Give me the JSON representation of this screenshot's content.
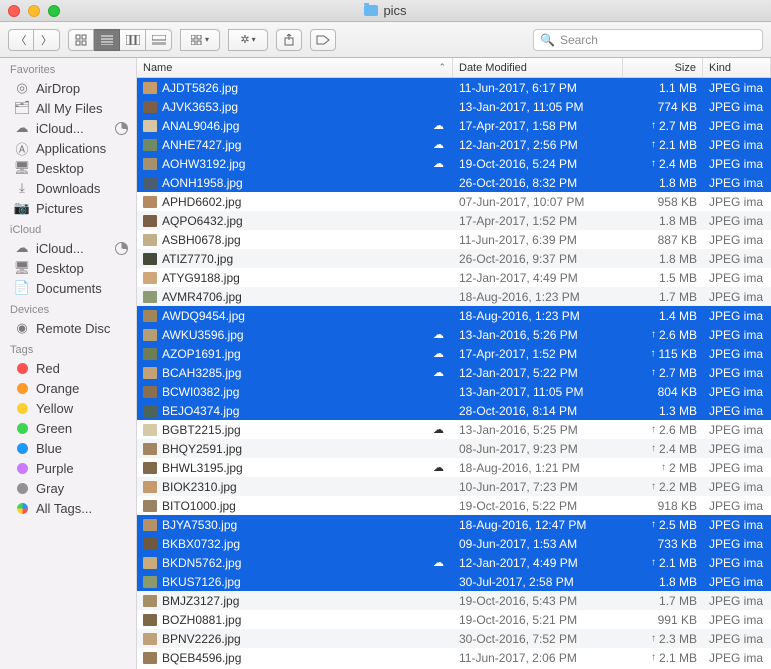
{
  "window": {
    "title": "pics"
  },
  "search": {
    "placeholder": "Search"
  },
  "sidebar": {
    "sections": [
      {
        "header": "Favorites",
        "items": [
          {
            "icon": "airdrop",
            "label": "AirDrop"
          },
          {
            "icon": "allfiles",
            "label": "All My Files"
          },
          {
            "icon": "cloud",
            "label": "iCloud...",
            "pie": true
          },
          {
            "icon": "apps",
            "label": "Applications"
          },
          {
            "icon": "desktop",
            "label": "Desktop"
          },
          {
            "icon": "downloads",
            "label": "Downloads"
          },
          {
            "icon": "pictures",
            "label": "Pictures"
          }
        ]
      },
      {
        "header": "iCloud",
        "items": [
          {
            "icon": "cloud",
            "label": "iCloud...",
            "pie": true
          },
          {
            "icon": "desktop",
            "label": "Desktop"
          },
          {
            "icon": "documents",
            "label": "Documents"
          }
        ]
      },
      {
        "header": "Devices",
        "items": [
          {
            "icon": "disc",
            "label": "Remote Disc"
          }
        ]
      },
      {
        "header": "Tags",
        "items": [
          {
            "dot": "red",
            "label": "Red"
          },
          {
            "dot": "orange",
            "label": "Orange"
          },
          {
            "dot": "yellow",
            "label": "Yellow"
          },
          {
            "dot": "green",
            "label": "Green"
          },
          {
            "dot": "blue",
            "label": "Blue"
          },
          {
            "dot": "purple",
            "label": "Purple"
          },
          {
            "dot": "gray",
            "label": "Gray"
          },
          {
            "dot": "all",
            "label": "All Tags..."
          }
        ]
      }
    ]
  },
  "columns": {
    "name": "Name",
    "date": "Date Modified",
    "size": "Size",
    "kind": "Kind"
  },
  "kind_label": "JPEG ima",
  "files": [
    {
      "name": "AJDT5826.jpg",
      "date": "11-Jun-2017, 6:17 PM",
      "size": "1.1 MB",
      "sel": true,
      "thumb": "#c99b6a"
    },
    {
      "name": "AJVK3653.jpg",
      "date": "13-Jan-2017, 11:05 PM",
      "size": "774 KB",
      "sel": true,
      "thumb": "#7d5f48"
    },
    {
      "name": "ANAL9046.jpg",
      "date": "17-Apr-2017, 1:58 PM",
      "size": "2.7 MB",
      "sel": true,
      "cloud": true,
      "up": true,
      "thumb": "#d8c7a2"
    },
    {
      "name": "ANHE7427.jpg",
      "date": "12-Jan-2017, 2:56 PM",
      "size": "2.1 MB",
      "sel": true,
      "cloud": true,
      "up": true,
      "thumb": "#6f8a64"
    },
    {
      "name": "AOHW3192.jpg",
      "date": "19-Oct-2016, 5:24 PM",
      "size": "2.4 MB",
      "sel": true,
      "cloud": true,
      "up": true,
      "thumb": "#a7916d"
    },
    {
      "name": "AONH1958.jpg",
      "date": "26-Oct-2016, 8:32 PM",
      "size": "1.8 MB",
      "sel": true,
      "thumb": "#4b5d6e"
    },
    {
      "name": "APHD6602.jpg",
      "date": "07-Jun-2017, 10:07 PM",
      "size": "958 KB",
      "sel": false,
      "thumb": "#b58a60"
    },
    {
      "name": "AQPO6432.jpg",
      "date": "17-Apr-2017, 1:52 PM",
      "size": "1.8 MB",
      "sel": false,
      "thumb": "#7c6045"
    },
    {
      "name": "ASBH0678.jpg",
      "date": "11-Jun-2017, 6:39 PM",
      "size": "887 KB",
      "sel": false,
      "thumb": "#c2b089"
    },
    {
      "name": "ATIZ7770.jpg",
      "date": "26-Oct-2016, 9:37 PM",
      "size": "1.8 MB",
      "sel": false,
      "thumb": "#454b3a"
    },
    {
      "name": "ATYG9188.jpg",
      "date": "12-Jan-2017, 4:49 PM",
      "size": "1.5 MB",
      "sel": false,
      "thumb": "#d0a77a"
    },
    {
      "name": "AVMR4706.jpg",
      "date": "18-Aug-2016, 1:23 PM",
      "size": "1.7 MB",
      "sel": false,
      "thumb": "#8e9c76"
    },
    {
      "name": "AWDQ9454.jpg",
      "date": "18-Aug-2016, 1:23 PM",
      "size": "1.4 MB",
      "sel": true,
      "thumb": "#a08658"
    },
    {
      "name": "AWKU3596.jpg",
      "date": "13-Jan-2016, 5:26 PM",
      "size": "2.6 MB",
      "sel": true,
      "cloud": true,
      "up": true,
      "thumb": "#b79d73"
    },
    {
      "name": "AZOP1691.jpg",
      "date": "17-Apr-2017, 1:52 PM",
      "size": "115 KB",
      "sel": true,
      "cloud": true,
      "up": true,
      "thumb": "#6d7d55"
    },
    {
      "name": "BCAH3285.jpg",
      "date": "12-Jan-2017, 5:22 PM",
      "size": "2.7 MB",
      "sel": true,
      "cloud": true,
      "up": true,
      "thumb": "#c5a178"
    },
    {
      "name": "BCWI0382.jpg",
      "date": "13-Jan-2017, 11:05 PM",
      "size": "804 KB",
      "sel": true,
      "thumb": "#8c6f4e"
    },
    {
      "name": "BEJO4374.jpg",
      "date": "28-Oct-2016, 8:14 PM",
      "size": "1.3 MB",
      "sel": true,
      "thumb": "#4e635a"
    },
    {
      "name": "BGBT2215.jpg",
      "date": "13-Jan-2016, 5:25 PM",
      "size": "2.6 MB",
      "sel": false,
      "cloud": true,
      "up": true,
      "thumb": "#d5c9a8"
    },
    {
      "name": "BHQY2591.jpg",
      "date": "08-Jun-2017, 9:23 PM",
      "size": "2.4 MB",
      "sel": false,
      "up": true,
      "thumb": "#a3855f"
    },
    {
      "name": "BHWL3195.jpg",
      "date": "18-Aug-2016, 1:21 PM",
      "size": "2 MB",
      "sel": false,
      "cloud": true,
      "up": true,
      "thumb": "#7f6b4a"
    },
    {
      "name": "BIOK2310.jpg",
      "date": "10-Jun-2017, 7:23 PM",
      "size": "2.2 MB",
      "sel": false,
      "up": true,
      "thumb": "#c79a6e"
    },
    {
      "name": "BITO1000.jpg",
      "date": "19-Oct-2016, 5:22 PM",
      "size": "918 KB",
      "sel": false,
      "thumb": "#9b8262"
    },
    {
      "name": "BJYA7530.jpg",
      "date": "18-Aug-2016, 12:47 PM",
      "size": "2.5 MB",
      "sel": true,
      "up": true,
      "thumb": "#b39267"
    },
    {
      "name": "BKBX0732.jpg",
      "date": "09-Jun-2017, 1:53 AM",
      "size": "733 KB",
      "sel": true,
      "thumb": "#6f5840"
    },
    {
      "name": "BKDN5762.jpg",
      "date": "12-Jan-2017, 4:49 PM",
      "size": "2.1 MB",
      "sel": true,
      "cloud": true,
      "up": true,
      "thumb": "#c9ab7c"
    },
    {
      "name": "BKUS7126.jpg",
      "date": "30-Jul-2017, 2:58 PM",
      "size": "1.8 MB",
      "sel": true,
      "thumb": "#8b9a6a"
    },
    {
      "name": "BMJZ3127.jpg",
      "date": "19-Oct-2016, 5:43 PM",
      "size": "1.7 MB",
      "sel": false,
      "thumb": "#a68e64"
    },
    {
      "name": "BOZH0881.jpg",
      "date": "19-Oct-2016, 5:21 PM",
      "size": "991 KB",
      "sel": false,
      "thumb": "#7e6848"
    },
    {
      "name": "BPNV2226.jpg",
      "date": "30-Oct-2016, 7:52 PM",
      "size": "2.3 MB",
      "sel": false,
      "up": true,
      "thumb": "#c0a27a"
    },
    {
      "name": "BQEB4596.jpg",
      "date": "11-Jun-2017, 2:06 PM",
      "size": "2.1 MB",
      "sel": false,
      "up": true,
      "thumb": "#9a7d57"
    }
  ]
}
